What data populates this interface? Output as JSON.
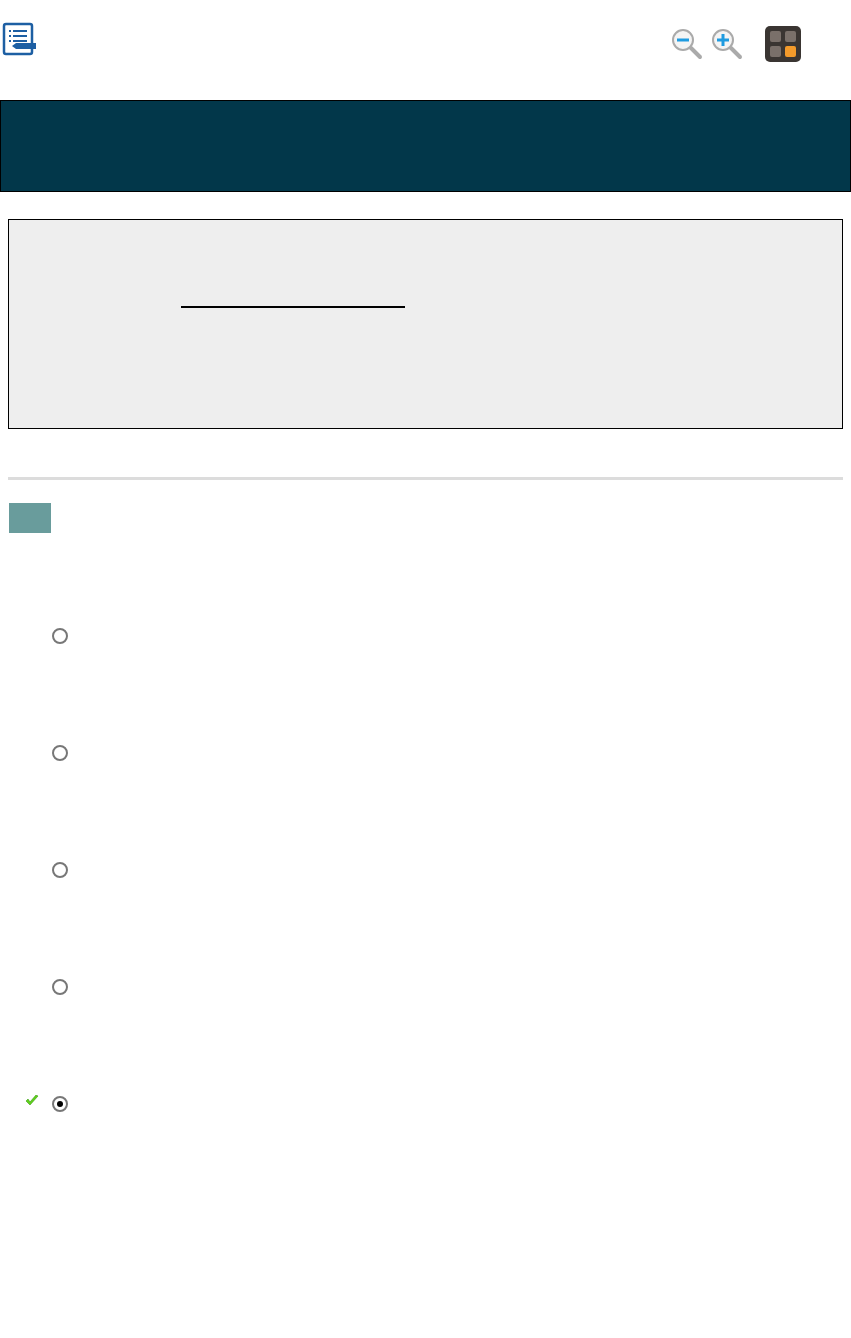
{
  "toolbar": {
    "tools": [
      {
        "kind": "zoom-out"
      },
      {
        "kind": "zoom-in"
      },
      {
        "kind": "calculator"
      }
    ]
  },
  "question": {
    "blank": {
      "kind": "fill-in-line"
    }
  },
  "options": [
    {
      "selected": false,
      "correct": false
    },
    {
      "selected": false,
      "correct": false
    },
    {
      "selected": false,
      "correct": false
    },
    {
      "selected": false,
      "correct": false
    },
    {
      "selected": true,
      "correct": true
    }
  ]
}
